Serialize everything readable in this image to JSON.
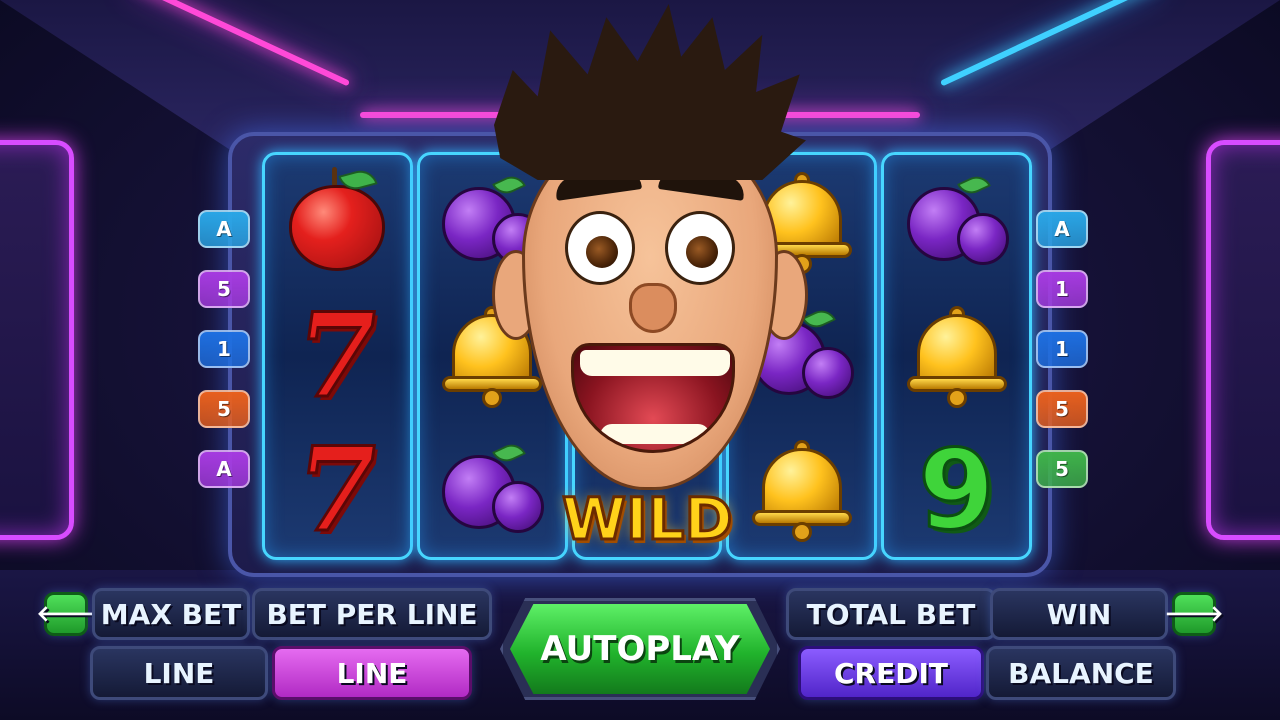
{
  "game": {
    "wild_label": "WILD"
  },
  "reels": [
    {
      "symbols": [
        {
          "name": "apple-icon"
        },
        {
          "name": "seven-icon",
          "text": "7"
        },
        {
          "name": "seven-icon",
          "text": "7"
        }
      ]
    },
    {
      "symbols": [
        {
          "name": "plum-icon"
        },
        {
          "name": "bell-icon"
        },
        {
          "name": "plum-icon"
        }
      ]
    },
    {
      "symbols": [
        {
          "name": "wild-character-icon"
        }
      ]
    },
    {
      "symbols": [
        {
          "name": "bell-icon"
        },
        {
          "name": "plum-icon"
        },
        {
          "name": "bell-icon"
        }
      ]
    },
    {
      "symbols": [
        {
          "name": "plum-icon"
        },
        {
          "name": "bell-icon"
        },
        {
          "name": "nine-icon",
          "text": "9"
        }
      ]
    }
  ],
  "paylines": {
    "left": [
      {
        "label": "A",
        "color": "#2aa6e6"
      },
      {
        "label": "5",
        "color": "#a63be0"
      },
      {
        "label": "1",
        "color": "#1e6fe0"
      },
      {
        "label": "5",
        "color": "#e8601e"
      },
      {
        "label": "A",
        "color": "#a63be0"
      }
    ],
    "right": [
      {
        "label": "A",
        "color": "#2aa6e6"
      },
      {
        "label": "1",
        "color": "#a63be0"
      },
      {
        "label": "1",
        "color": "#1e6fe0"
      },
      {
        "label": "5",
        "color": "#e8601e"
      },
      {
        "label": "5",
        "color": "#3fb34a"
      }
    ]
  },
  "controls": {
    "prev_arrow": "🡐",
    "next_arrow": "🡒",
    "max_bet": "MAX BET",
    "bet_per_line": "BET PER LINE",
    "line_1": "LINE",
    "line_2": "LINE",
    "autoplay": "AUTOPLAY",
    "total_bet": "TOTAL BET",
    "win": "WIN",
    "credit": "CREDIT",
    "balance": "BALANCE"
  },
  "colors": {
    "accent_green": "#21b32c",
    "neon_pink": "#ff49d8",
    "neon_cyan": "#3fd1ff",
    "wild_gold": "#ffd21a"
  }
}
